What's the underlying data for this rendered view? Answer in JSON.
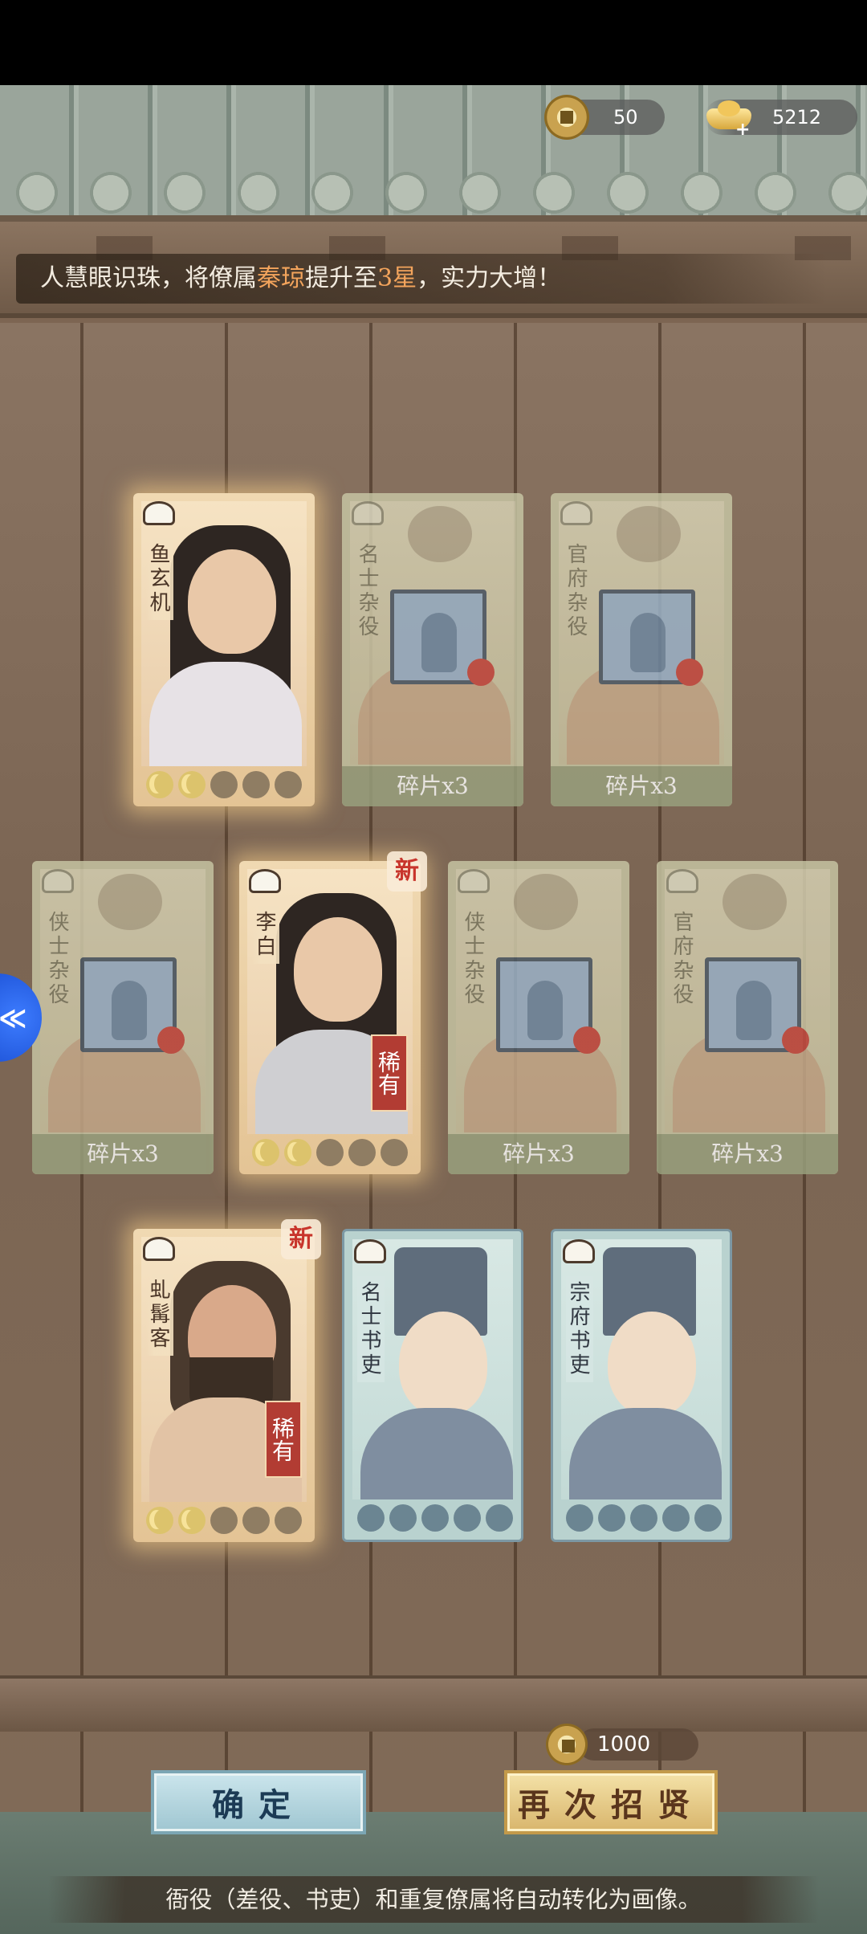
{
  "currency": {
    "coins": "50",
    "ingots": "5212"
  },
  "message": {
    "prefix": "人慧眼识珠，将僚属",
    "hero": "秦琼",
    "middle": "提升至",
    "stars": "3星",
    "suffix": "，实力大增！"
  },
  "cards": [
    {
      "kind": "hero",
      "name": "鱼玄机",
      "rarity_label": "",
      "is_new": false,
      "stars_filled": 2,
      "stars_total": 5
    },
    {
      "kind": "fragment",
      "name": "名士杂役",
      "fragment_label": "碎片x3"
    },
    {
      "kind": "fragment",
      "name": "官府杂役",
      "fragment_label": "碎片x3"
    },
    {
      "kind": "fragment",
      "name": "侠士杂役",
      "fragment_label": "碎片x3"
    },
    {
      "kind": "hero",
      "name": "李白",
      "rarity_label": "稀有",
      "is_new": true,
      "new_label": "新",
      "stars_filled": 2,
      "stars_total": 5
    },
    {
      "kind": "fragment",
      "name": "侠士杂役",
      "fragment_label": "碎片x3"
    },
    {
      "kind": "fragment",
      "name": "官府杂役",
      "fragment_label": "碎片x3"
    },
    {
      "kind": "hero",
      "name": "虬髯客",
      "rarity_label": "稀有",
      "is_new": true,
      "new_label": "新",
      "stars_filled": 2,
      "stars_total": 5
    },
    {
      "kind": "clerk",
      "name": "名士书吏",
      "stars_filled": 0,
      "stars_total": 5
    },
    {
      "kind": "clerk",
      "name": "宗府书吏",
      "stars_filled": 0,
      "stars_total": 5
    }
  ],
  "recruit_cost": "1000",
  "buttons": {
    "confirm": "确定",
    "recruit_again": "再次招贤"
  },
  "bottom_tip": "衙役（差役、书吏）和重复僚属将自动转化为画像。",
  "side_handle_glyph": "≪",
  "colors": {
    "highlight": "#f3a45c",
    "rare_tag": "#b23c33",
    "confirm_button": "#9fc6d1",
    "recruit_button": "#d8b56c"
  }
}
